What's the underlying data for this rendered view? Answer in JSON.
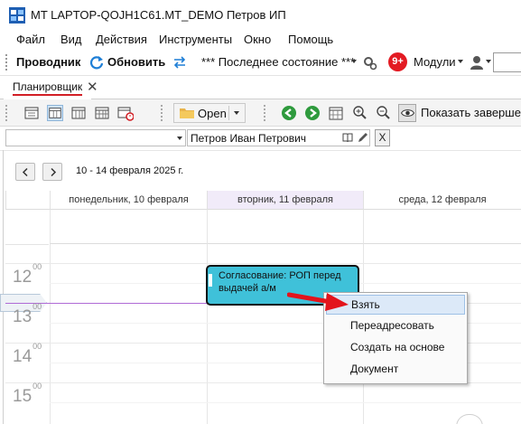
{
  "window": {
    "title": "MT LAPTOP-QOJH1C61.MT_DEMO Петров ИП"
  },
  "menu": {
    "items": [
      "Файл",
      "Вид",
      "Действия",
      "Инструменты",
      "Окно",
      "Помощь"
    ]
  },
  "toolbar": {
    "explorer_label": "Проводник",
    "refresh_label": "Обновить",
    "state_value": "*** Последнее состояние ***",
    "notifications_count": "9+",
    "modules_label": "Модули"
  },
  "tabs": {
    "active_label": "Планировщик",
    "close_glyph": "✕"
  },
  "scheduler_toolbar": {
    "open_label": "Open",
    "show_completed_label": "Показать завершенн"
  },
  "filter": {
    "person": "Петров Иван Петрович",
    "clear_label": "X"
  },
  "calendar": {
    "date_range": "10 - 14 февраля 2025 г.",
    "days": [
      "понедельник, 10 февраля",
      "вторник, 11 февраля",
      "среда, 12 февраля"
    ],
    "hours": [
      "12",
      "13",
      "14",
      "15"
    ],
    "hour_minutes": "00"
  },
  "event": {
    "title": "Согласование: РОП перед выдачей а/м",
    "color": "#3fc1d9"
  },
  "context_menu": {
    "items": [
      "Взять",
      "Переадресовать",
      "Создать на основе",
      "Документ"
    ]
  },
  "colors": {
    "accent_red": "#d21f26",
    "highlight": "#dce9f8",
    "today_header": "#f1ebf9",
    "now_line": "#b06bd6"
  }
}
